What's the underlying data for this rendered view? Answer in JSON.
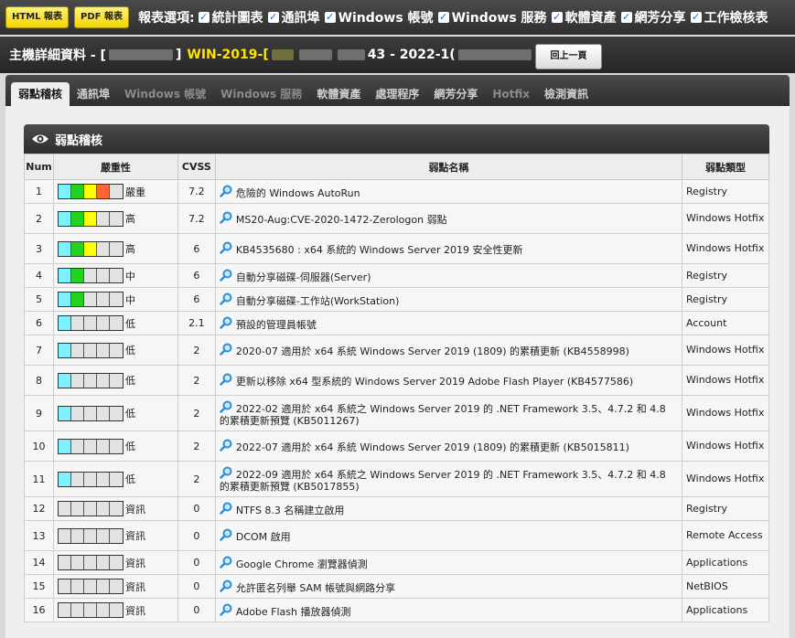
{
  "toolbar": {
    "html_btn": "HTML 報表",
    "pdf_btn": "PDF 報表",
    "options_label": "報表選項:",
    "options": [
      "統計圖表",
      "通訊埠",
      "Windows 帳號",
      "Windows 服務",
      "軟體資產",
      "網芳分享",
      "工作檢核表"
    ]
  },
  "detail": {
    "prefix": "主機詳細資料 - [",
    "bracket_close": "]",
    "host": "WIN-2019-[",
    "mid": "43 - 2022-1(",
    "back": "回上一頁"
  },
  "tabs": [
    {
      "label": "弱點稽核",
      "state": "active"
    },
    {
      "label": "通訊埠",
      "state": "normal"
    },
    {
      "label": "Windows 帳號",
      "state": "dim"
    },
    {
      "label": "Windows 服務",
      "state": "dim"
    },
    {
      "label": "軟體資產",
      "state": "normal"
    },
    {
      "label": "處理程序",
      "state": "normal"
    },
    {
      "label": "網芳分享",
      "state": "normal"
    },
    {
      "label": "Hotfix",
      "state": "dim"
    },
    {
      "label": "檢測資訊",
      "state": "normal"
    }
  ],
  "panel_title": "弱點稽核",
  "columns": [
    "Num",
    "嚴重性",
    "CVSS",
    "弱點名稱",
    "弱點類型"
  ],
  "colors": {
    "cyan": "#7ff0ff",
    "green": "#22d322",
    "yellow": "#ffff00",
    "orange": "#ff6633",
    "empty": "#e3e3e3",
    "link_icon": "#2b8fd6"
  },
  "rows": [
    {
      "num": "1",
      "sev": "嚴重",
      "segs": [
        "cyan",
        "green",
        "yellow",
        "orange",
        "empty"
      ],
      "cvss": "7.2",
      "name": "危險的 Windows AutoRun",
      "type": "Registry"
    },
    {
      "num": "2",
      "sev": "高",
      "segs": [
        "cyan",
        "green",
        "yellow",
        "empty",
        "empty"
      ],
      "cvss": "7.2",
      "name": "MS20-Aug:CVE-2020-1472-Zerologon 弱點",
      "type": "Windows Hotfix"
    },
    {
      "num": "3",
      "sev": "高",
      "segs": [
        "cyan",
        "green",
        "yellow",
        "empty",
        "empty"
      ],
      "cvss": "6",
      "name": "KB4535680 : x64 系統的 Windows Server 2019 安全性更新",
      "type": "Windows Hotfix"
    },
    {
      "num": "4",
      "sev": "中",
      "segs": [
        "cyan",
        "green",
        "empty",
        "empty",
        "empty"
      ],
      "cvss": "6",
      "name": "自動分享磁碟-伺服器(Server)",
      "type": "Registry"
    },
    {
      "num": "5",
      "sev": "中",
      "segs": [
        "cyan",
        "green",
        "empty",
        "empty",
        "empty"
      ],
      "cvss": "6",
      "name": "自動分享磁碟-工作站(WorkStation)",
      "type": "Registry"
    },
    {
      "num": "6",
      "sev": "低",
      "segs": [
        "cyan",
        "empty",
        "empty",
        "empty",
        "empty"
      ],
      "cvss": "2.1",
      "name": "預設的管理員帳號",
      "type": "Account"
    },
    {
      "num": "7",
      "sev": "低",
      "segs": [
        "cyan",
        "empty",
        "empty",
        "empty",
        "empty"
      ],
      "cvss": "2",
      "name": "2020-07 適用於 x64 系統 Windows Server 2019 (1809) 的累積更新 (KB4558998)",
      "type": "Windows Hotfix"
    },
    {
      "num": "8",
      "sev": "低",
      "segs": [
        "cyan",
        "empty",
        "empty",
        "empty",
        "empty"
      ],
      "cvss": "2",
      "name": "更新以移除 x64 型系統的 Windows Server 2019 Adobe Flash Player (KB4577586)",
      "type": "Windows Hotfix"
    },
    {
      "num": "9",
      "sev": "低",
      "segs": [
        "cyan",
        "empty",
        "empty",
        "empty",
        "empty"
      ],
      "cvss": "2",
      "name": "2022-02 適用於 x64 系統之 Windows Server 2019 的 .NET Framework 3.5、4.7.2 和 4.8 的累積更新預覽 (KB5011267)",
      "type": "Windows Hotfix"
    },
    {
      "num": "10",
      "sev": "低",
      "segs": [
        "cyan",
        "empty",
        "empty",
        "empty",
        "empty"
      ],
      "cvss": "2",
      "name": "2022-07 適用於 x64 系統 Windows Server 2019 (1809) 的累積更新 (KB5015811)",
      "type": "Windows Hotfix"
    },
    {
      "num": "11",
      "sev": "低",
      "segs": [
        "cyan",
        "empty",
        "empty",
        "empty",
        "empty"
      ],
      "cvss": "2",
      "name": "2022-09 適用於 x64 系統之 Windows Server 2019 的 .NET Framework 3.5、4.7.2 和 4.8 的累積更新預覽 (KB5017855)",
      "type": "Windows Hotfix"
    },
    {
      "num": "12",
      "sev": "資訊",
      "segs": [
        "empty",
        "empty",
        "empty",
        "empty",
        "empty"
      ],
      "cvss": "0",
      "name": "NTFS 8.3 名稱建立啟用",
      "type": "Registry"
    },
    {
      "num": "13",
      "sev": "資訊",
      "segs": [
        "empty",
        "empty",
        "empty",
        "empty",
        "empty"
      ],
      "cvss": "0",
      "name": "DCOM 啟用",
      "type": "Remote Access"
    },
    {
      "num": "14",
      "sev": "資訊",
      "segs": [
        "empty",
        "empty",
        "empty",
        "empty",
        "empty"
      ],
      "cvss": "0",
      "name": "Google Chrome 瀏覽器偵測",
      "type": "Applications"
    },
    {
      "num": "15",
      "sev": "資訊",
      "segs": [
        "empty",
        "empty",
        "empty",
        "empty",
        "empty"
      ],
      "cvss": "0",
      "name": "允許匿名列舉 SAM 帳號與網路分享",
      "type": "NetBIOS"
    },
    {
      "num": "16",
      "sev": "資訊",
      "segs": [
        "empty",
        "empty",
        "empty",
        "empty",
        "empty"
      ],
      "cvss": "0",
      "name": "Adobe Flash 播放器偵測",
      "type": "Applications"
    }
  ]
}
